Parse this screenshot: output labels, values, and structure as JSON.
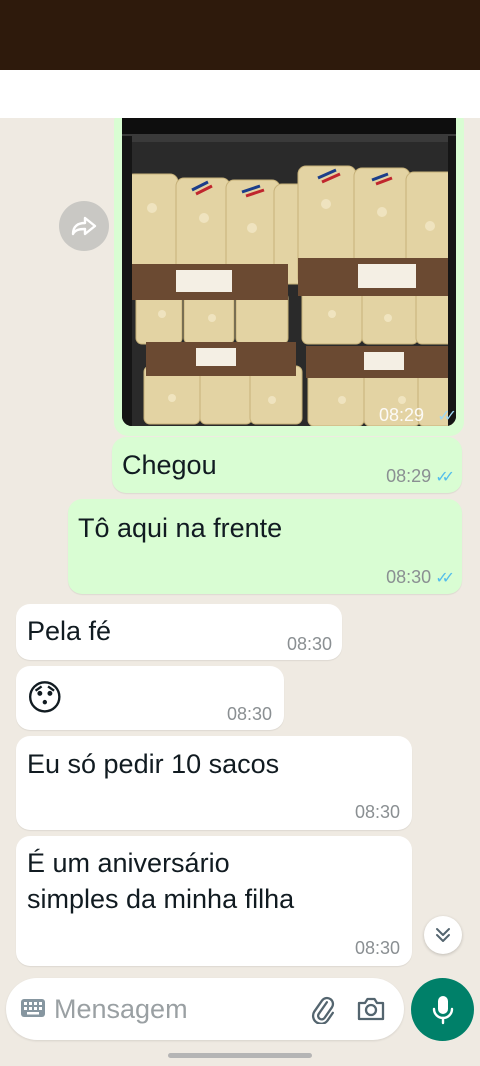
{
  "messages": [
    {
      "text": "Chegou",
      "time": "08:29",
      "status": "read"
    },
    {
      "text": "Tô aqui na frente",
      "time": "08:30",
      "status": "read"
    },
    {
      "text": "Pela fé",
      "time": "08:30"
    },
    {
      "emoji": "😯",
      "time": "08:30"
    },
    {
      "text": "Eu só pedir 10 sacos",
      "time": "08:30"
    },
    {
      "text_line1": "É um aniversário",
      "text_line2": "simples da minha filha",
      "time": "08:30"
    }
  ],
  "image_message": {
    "time": "08:29",
    "status": "read"
  },
  "composer": {
    "placeholder": "Mensagem"
  },
  "icons": {
    "forward": "forward-icon",
    "scroll": "chevron-double-down-icon",
    "keyboard": "keyboard-icon",
    "attach": "paperclip-icon",
    "camera": "camera-icon",
    "mic": "microphone-icon"
  },
  "colors": {
    "outgoing_bubble": "#d9fdd3",
    "incoming_bubble": "#ffffff",
    "chat_background": "#efeae2",
    "read_ticks": "#53bdeb",
    "accent": "#008069"
  }
}
